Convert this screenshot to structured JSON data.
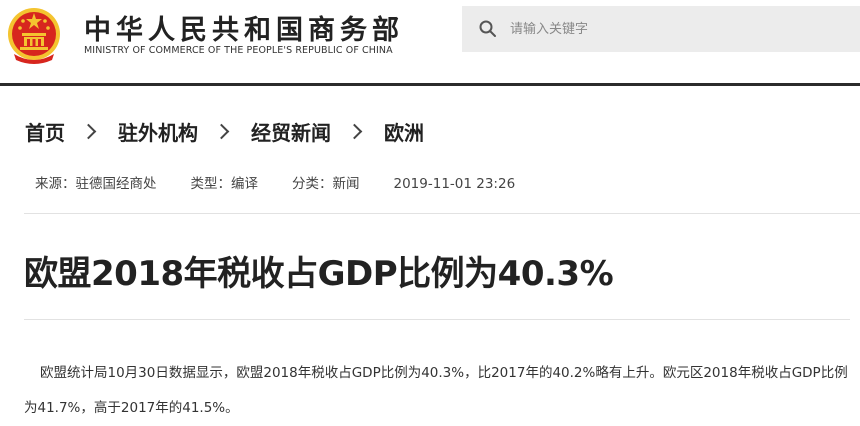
{
  "header": {
    "site_title": "中华人民共和国商务部",
    "site_subtitle": "MINISTRY OF COMMERCE OF THE PEOPLE'S REPUBLIC OF CHINA",
    "search_placeholder": "请输入关键字"
  },
  "breadcrumb": [
    "首页",
    "驻外机构",
    "经贸新闻",
    "欧洲"
  ],
  "meta": {
    "source": "来源：驻德国经商处",
    "type": "类型：编译",
    "category": "分类：新闻",
    "datetime": "2019-11-01 23:26"
  },
  "article": {
    "title": "欧盟2018年税收占GDP比例为40.3%",
    "body": "欧盟统计局10月30日数据显示，欧盟2018年税收占GDP比例为40.3%，比2017年的40.2%略有上升。欧元区2018年税收占GDP比例为41.7%，高于2017年的41.5%。"
  },
  "colors": {
    "emblem_red": "#d7261e",
    "emblem_gold": "#f4c430",
    "divider_dark": "#2b2b2b",
    "search_bg": "#ececec"
  }
}
